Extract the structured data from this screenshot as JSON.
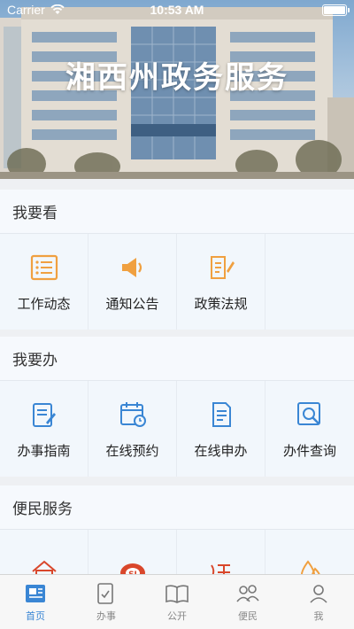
{
  "status": {
    "carrier": "Carrier",
    "time": "10:53 AM"
  },
  "banner": {
    "title": "湘西州政务服务"
  },
  "sections": [
    {
      "title": "我要看",
      "items": [
        {
          "label": "工作动态",
          "icon": "list-icon"
        },
        {
          "label": "通知公告",
          "icon": "megaphone-icon"
        },
        {
          "label": "政策法规",
          "icon": "document-edit-icon"
        }
      ]
    },
    {
      "title": "我要办",
      "items": [
        {
          "label": "办事指南",
          "icon": "clipboard-pen-icon"
        },
        {
          "label": "在线预约",
          "icon": "calendar-clock-icon"
        },
        {
          "label": "在线申办",
          "icon": "application-doc-icon"
        },
        {
          "label": "办件查询",
          "icon": "search-doc-icon"
        }
      ]
    },
    {
      "title": "便民服务",
      "items": [
        {
          "label": "",
          "icon": "house-yuan-icon"
        },
        {
          "label": "",
          "icon": "social-security-icon"
        },
        {
          "label": "",
          "icon": "tax-icon"
        },
        {
          "label": "",
          "icon": "water-drop-icon"
        }
      ]
    }
  ],
  "tabs": [
    {
      "label": "首页",
      "icon": "home-news-icon",
      "active": true
    },
    {
      "label": "办事",
      "icon": "checklist-icon",
      "active": false
    },
    {
      "label": "公开",
      "icon": "book-icon",
      "active": false
    },
    {
      "label": "便民",
      "icon": "people-icon",
      "active": false
    },
    {
      "label": "我",
      "icon": "person-icon",
      "active": false
    }
  ],
  "colors": {
    "orange": "#f0a040",
    "blue": "#3a86d4",
    "red": "#d9472b"
  }
}
